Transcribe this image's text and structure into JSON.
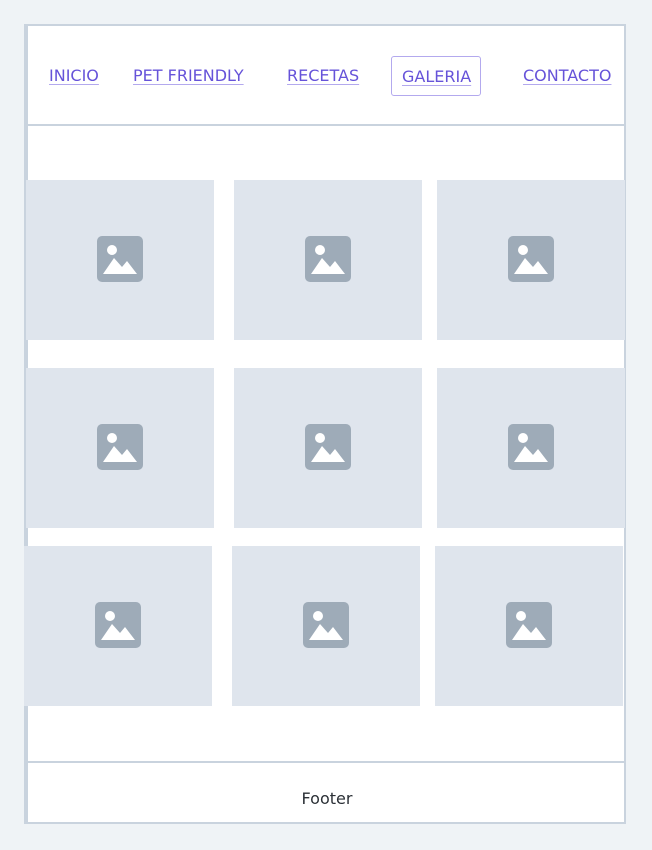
{
  "nav": {
    "items": [
      {
        "label": "INICIO"
      },
      {
        "label": "PET FRIENDLY"
      },
      {
        "label": "RECETAS"
      },
      {
        "label": "GALERIA",
        "active": true
      },
      {
        "label": "CONTACTO"
      }
    ]
  },
  "gallery": {
    "icon": "image-placeholder-icon",
    "tile_count": 9,
    "colors": {
      "tile": "#dfe5ed",
      "icon": "#9eabb8"
    }
  },
  "footer": {
    "text": "Footer"
  },
  "colors": {
    "link": "#6653d9",
    "border": "#c9d3de",
    "background": "#eff3f6"
  }
}
